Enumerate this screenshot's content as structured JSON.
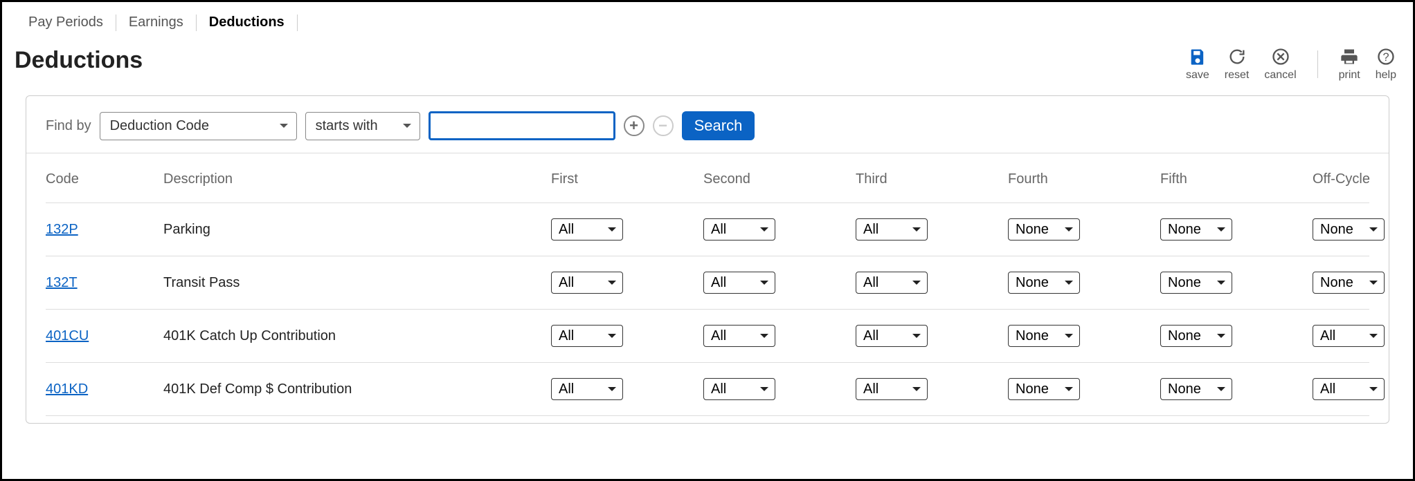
{
  "tabs": [
    "Pay Periods",
    "Earnings",
    "Deductions"
  ],
  "activeTab": "Deductions",
  "pageTitle": "Deductions",
  "toolbar": {
    "save": "save",
    "reset": "reset",
    "cancel": "cancel",
    "print": "print",
    "help": "help"
  },
  "findbar": {
    "label": "Find by",
    "field": "Deduction Code",
    "operator": "starts with",
    "inputValue": "",
    "searchLabel": "Search"
  },
  "columns": [
    "Code",
    "Description",
    "First",
    "Second",
    "Third",
    "Fourth",
    "Fifth",
    "Off-Cycle"
  ],
  "selectOptions": [
    "All",
    "None"
  ],
  "rows": [
    {
      "code": "132P",
      "description": "Parking",
      "first": "All",
      "second": "All",
      "third": "All",
      "fourth": "None",
      "fifth": "None",
      "offcycle": "None"
    },
    {
      "code": "132T",
      "description": "Transit Pass",
      "first": "All",
      "second": "All",
      "third": "All",
      "fourth": "None",
      "fifth": "None",
      "offcycle": "None"
    },
    {
      "code": "401CU",
      "description": "401K Catch Up Contribution",
      "first": "All",
      "second": "All",
      "third": "All",
      "fourth": "None",
      "fifth": "None",
      "offcycle": "All"
    },
    {
      "code": "401KD",
      "description": "401K Def Comp $ Contribution",
      "first": "All",
      "second": "All",
      "third": "All",
      "fourth": "None",
      "fifth": "None",
      "offcycle": "All"
    }
  ]
}
